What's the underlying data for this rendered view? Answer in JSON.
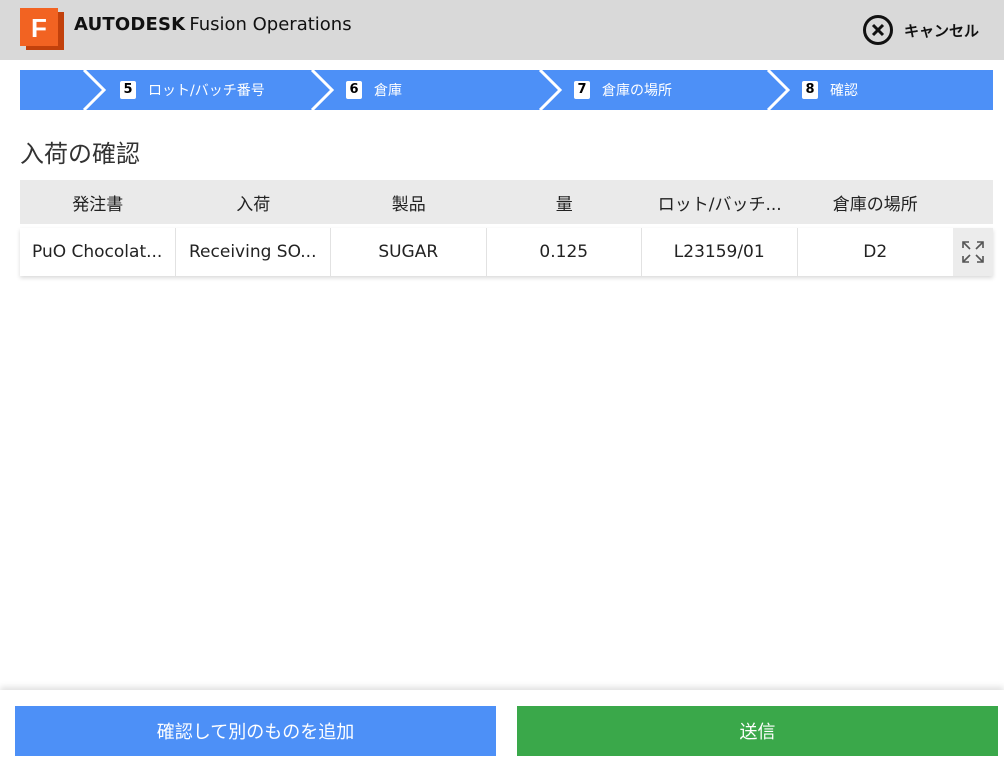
{
  "header": {
    "brand_bold": "AUTODESK",
    "brand_product": "Fusion Operations",
    "logo_letter": "F",
    "cancel_label": "キャンセル"
  },
  "steps": [
    {
      "number": "5",
      "label": "ロット/バッチ番号"
    },
    {
      "number": "6",
      "label": "倉庫"
    },
    {
      "number": "7",
      "label": "倉庫の場所"
    },
    {
      "number": "8",
      "label": "確認"
    }
  ],
  "page_title": "入荷の確認",
  "table": {
    "headers": [
      "発注書",
      "入荷",
      "製品",
      "量",
      "ロット/バッチ...",
      "倉庫の場所"
    ],
    "rows": [
      [
        "PuO Chocolat...",
        "Receiving SO...",
        "SUGAR",
        "0.125",
        "L23159/01",
        "D2"
      ]
    ]
  },
  "footer": {
    "add_label": "確認して別のものを追加",
    "send_label": "送信"
  },
  "colors": {
    "step_blue": "#4d90f7",
    "send_green": "#3aa84a",
    "logo_orange": "#f26322"
  }
}
